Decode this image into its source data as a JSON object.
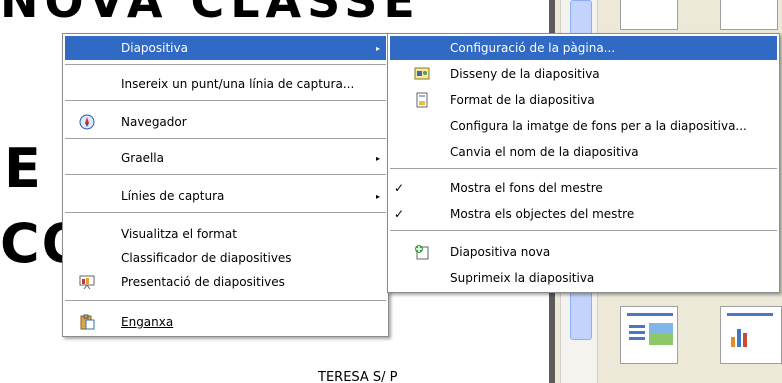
{
  "slide": {
    "title_fragment": "NOVA CLASSE",
    "letter_e": "E",
    "letter_co": "CO",
    "footer_fragment": "TERESA   S/ P"
  },
  "main_menu": {
    "diapositiva": "Diapositiva",
    "insert_capture": "Insereix un punt/una línia de captura...",
    "navegador": "Navegador",
    "graella": "Graella",
    "linies_captura": "Línies de captura",
    "visualitza_format": "Visualitza el format",
    "classificador": "Classificador de diapositives",
    "presentacio": "Presentació de diapositives",
    "enganxa": "Enganxa"
  },
  "sub_menu": {
    "config_pagina": "Configuració de la pàgina...",
    "disseny": "Disseny de la diapositiva",
    "format": "Format de la diapositiva",
    "configura_fons": "Configura la imatge de fons per a la diapositiva...",
    "canvia_nom": "Canvia el nom de la diapositiva",
    "mostra_fons": "Mostra el fons del mestre",
    "mostra_objectes": "Mostra els objectes del mestre",
    "diapositiva_nova": "Diapositiva nova",
    "suprimeix": "Suprimeix la diapositiva"
  },
  "icons": {
    "submenu_arrow": "▸",
    "check": "✓"
  },
  "colors": {
    "highlight": "#316ac5",
    "menu_bg": "#ffffff",
    "panel_bg": "#ece9d8"
  }
}
